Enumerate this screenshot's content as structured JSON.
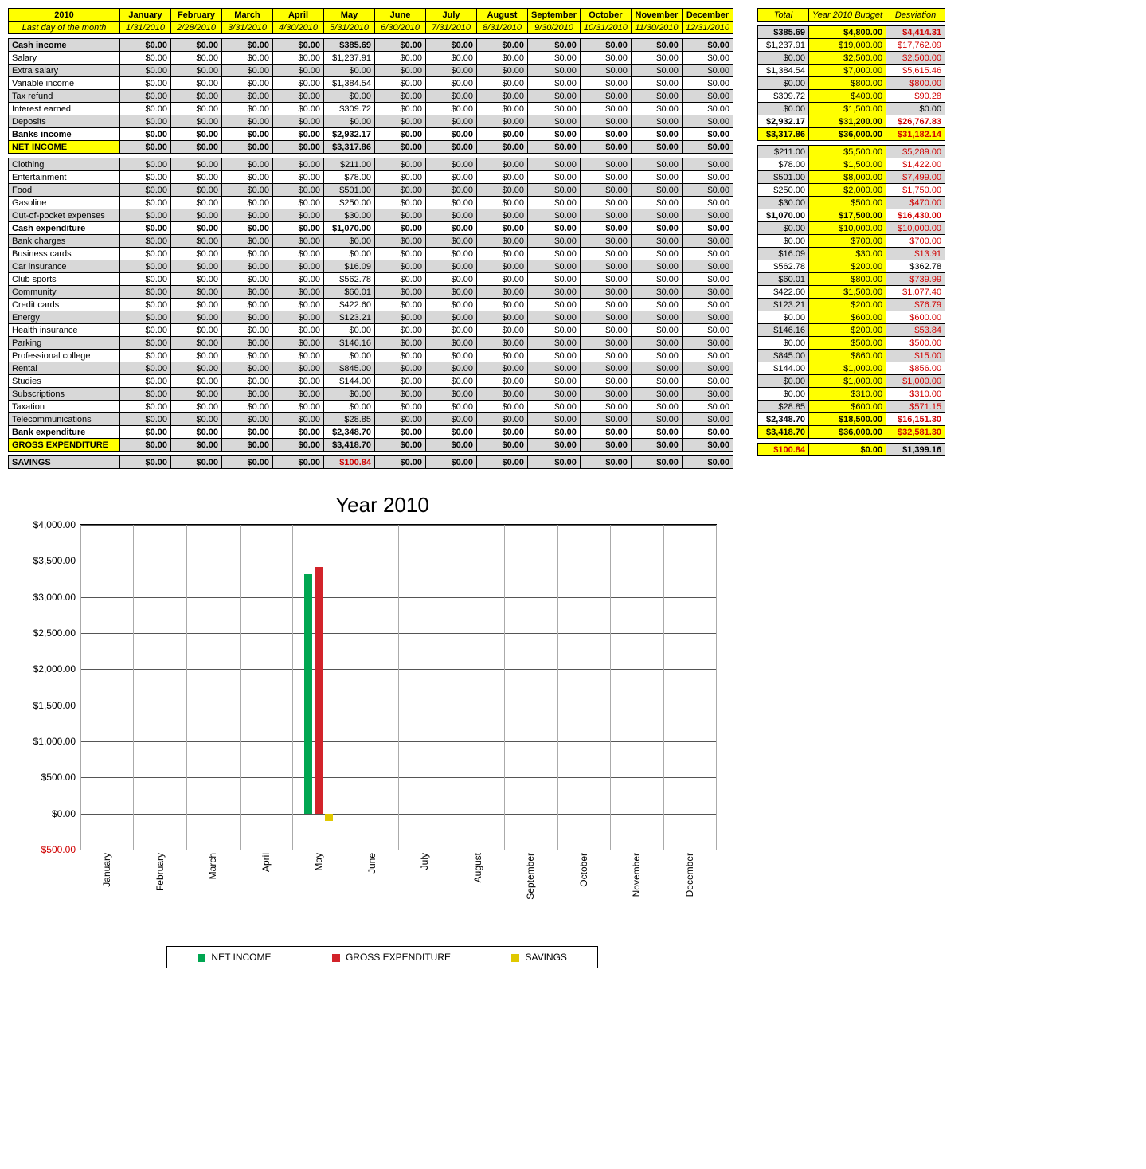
{
  "header": {
    "year_label": "2010",
    "sub_label": "Last day of the month",
    "months": [
      "January",
      "February",
      "March",
      "April",
      "May",
      "June",
      "July",
      "August",
      "September",
      "October",
      "November",
      "December"
    ],
    "dates": [
      "1/31/2010",
      "2/28/2010",
      "3/31/2010",
      "4/30/2010",
      "5/31/2010",
      "6/30/2010",
      "7/31/2010",
      "8/31/2010",
      "9/30/2010",
      "10/31/2010",
      "11/30/2010",
      "12/31/2010"
    ],
    "total_label": "Total",
    "budget_label": "Year 2010 Budget",
    "deviation_label": "Desviation"
  },
  "rows": [
    {
      "label": "Cash income",
      "type": "shade-bold",
      "vals": [
        "$0.00",
        "$0.00",
        "$0.00",
        "$0.00",
        "$385.69",
        "$0.00",
        "$0.00",
        "$0.00",
        "$0.00",
        "$0.00",
        "$0.00",
        "$0.00"
      ],
      "total": "$385.69",
      "budget": "$4,800.00",
      "dev": "$4,414.31",
      "dev_red": true
    },
    {
      "label": "Salary",
      "type": "plain",
      "vals": [
        "$0.00",
        "$0.00",
        "$0.00",
        "$0.00",
        "$1,237.91",
        "$0.00",
        "$0.00",
        "$0.00",
        "$0.00",
        "$0.00",
        "$0.00",
        "$0.00"
      ],
      "total": "$1,237.91",
      "budget": "$19,000.00",
      "dev": "$17,762.09",
      "dev_red": true
    },
    {
      "label": "Extra salary",
      "type": "shade",
      "vals": [
        "$0.00",
        "$0.00",
        "$0.00",
        "$0.00",
        "$0.00",
        "$0.00",
        "$0.00",
        "$0.00",
        "$0.00",
        "$0.00",
        "$0.00",
        "$0.00"
      ],
      "total": "$0.00",
      "budget": "$2,500.00",
      "dev": "$2,500.00",
      "dev_red": true
    },
    {
      "label": "Variable income",
      "type": "plain",
      "vals": [
        "$0.00",
        "$0.00",
        "$0.00",
        "$0.00",
        "$1,384.54",
        "$0.00",
        "$0.00",
        "$0.00",
        "$0.00",
        "$0.00",
        "$0.00",
        "$0.00"
      ],
      "total": "$1,384.54",
      "budget": "$7,000.00",
      "dev": "$5,615.46",
      "dev_red": true
    },
    {
      "label": "Tax refund",
      "type": "shade",
      "vals": [
        "$0.00",
        "$0.00",
        "$0.00",
        "$0.00",
        "$0.00",
        "$0.00",
        "$0.00",
        "$0.00",
        "$0.00",
        "$0.00",
        "$0.00",
        "$0.00"
      ],
      "total": "$0.00",
      "budget": "$800.00",
      "dev": "$800.00",
      "dev_red": true
    },
    {
      "label": "Interest earned",
      "type": "plain",
      "vals": [
        "$0.00",
        "$0.00",
        "$0.00",
        "$0.00",
        "$309.72",
        "$0.00",
        "$0.00",
        "$0.00",
        "$0.00",
        "$0.00",
        "$0.00",
        "$0.00"
      ],
      "total": "$309.72",
      "budget": "$400.00",
      "dev": "$90.28",
      "dev_red": true
    },
    {
      "label": "Deposits",
      "type": "shade",
      "vals": [
        "$0.00",
        "$0.00",
        "$0.00",
        "$0.00",
        "$0.00",
        "$0.00",
        "$0.00",
        "$0.00",
        "$0.00",
        "$0.00",
        "$0.00",
        "$0.00"
      ],
      "total": "$0.00",
      "budget": "$1,500.00",
      "dev": "$0.00",
      "dev_red": false
    },
    {
      "label": "Banks income",
      "type": "plain-bold",
      "vals": [
        "$0.00",
        "$0.00",
        "$0.00",
        "$0.00",
        "$2,932.17",
        "$0.00",
        "$0.00",
        "$0.00",
        "$0.00",
        "$0.00",
        "$0.00",
        "$0.00"
      ],
      "total": "$2,932.17",
      "budget": "$31,200.00",
      "dev": "$26,767.83",
      "dev_red": true
    },
    {
      "label": "NET INCOME",
      "type": "yellow",
      "vals": [
        "$0.00",
        "$0.00",
        "$0.00",
        "$0.00",
        "$3,317.86",
        "$0.00",
        "$0.00",
        "$0.00",
        "$0.00",
        "$0.00",
        "$0.00",
        "$0.00"
      ],
      "total": "$3,317.86",
      "budget": "$36,000.00",
      "dev": "$31,182.14",
      "dev_red": true
    },
    {
      "type": "spacer"
    },
    {
      "label": "Clothing",
      "type": "shade",
      "vals": [
        "$0.00",
        "$0.00",
        "$0.00",
        "$0.00",
        "$211.00",
        "$0.00",
        "$0.00",
        "$0.00",
        "$0.00",
        "$0.00",
        "$0.00",
        "$0.00"
      ],
      "total": "$211.00",
      "budget": "$5,500.00",
      "dev": "$5,289.00",
      "dev_red": true
    },
    {
      "label": "Entertainment",
      "type": "plain",
      "vals": [
        "$0.00",
        "$0.00",
        "$0.00",
        "$0.00",
        "$78.00",
        "$0.00",
        "$0.00",
        "$0.00",
        "$0.00",
        "$0.00",
        "$0.00",
        "$0.00"
      ],
      "total": "$78.00",
      "budget": "$1,500.00",
      "dev": "$1,422.00",
      "dev_red": true
    },
    {
      "label": "Food",
      "type": "shade",
      "vals": [
        "$0.00",
        "$0.00",
        "$0.00",
        "$0.00",
        "$501.00",
        "$0.00",
        "$0.00",
        "$0.00",
        "$0.00",
        "$0.00",
        "$0.00",
        "$0.00"
      ],
      "total": "$501.00",
      "budget": "$8,000.00",
      "dev": "$7,499.00",
      "dev_red": true
    },
    {
      "label": "Gasoline",
      "type": "plain",
      "vals": [
        "$0.00",
        "$0.00",
        "$0.00",
        "$0.00",
        "$250.00",
        "$0.00",
        "$0.00",
        "$0.00",
        "$0.00",
        "$0.00",
        "$0.00",
        "$0.00"
      ],
      "total": "$250.00",
      "budget": "$2,000.00",
      "dev": "$1,750.00",
      "dev_red": true
    },
    {
      "label": "Out-of-pocket expenses",
      "type": "shade",
      "vals": [
        "$0.00",
        "$0.00",
        "$0.00",
        "$0.00",
        "$30.00",
        "$0.00",
        "$0.00",
        "$0.00",
        "$0.00",
        "$0.00",
        "$0.00",
        "$0.00"
      ],
      "total": "$30.00",
      "budget": "$500.00",
      "dev": "$470.00",
      "dev_red": true
    },
    {
      "label": "Cash expenditure",
      "type": "plain-bold",
      "vals": [
        "$0.00",
        "$0.00",
        "$0.00",
        "$0.00",
        "$1,070.00",
        "$0.00",
        "$0.00",
        "$0.00",
        "$0.00",
        "$0.00",
        "$0.00",
        "$0.00"
      ],
      "total": "$1,070.00",
      "budget": "$17,500.00",
      "dev": "$16,430.00",
      "dev_red": true
    },
    {
      "label": "Bank charges",
      "type": "shade",
      "vals": [
        "$0.00",
        "$0.00",
        "$0.00",
        "$0.00",
        "$0.00",
        "$0.00",
        "$0.00",
        "$0.00",
        "$0.00",
        "$0.00",
        "$0.00",
        "$0.00"
      ],
      "total": "$0.00",
      "budget": "$10,000.00",
      "dev": "$10,000.00",
      "dev_red": true
    },
    {
      "label": "Business cards",
      "type": "plain",
      "vals": [
        "$0.00",
        "$0.00",
        "$0.00",
        "$0.00",
        "$0.00",
        "$0.00",
        "$0.00",
        "$0.00",
        "$0.00",
        "$0.00",
        "$0.00",
        "$0.00"
      ],
      "total": "$0.00",
      "budget": "$700.00",
      "dev": "$700.00",
      "dev_red": true
    },
    {
      "label": "Car insurance",
      "type": "shade",
      "vals": [
        "$0.00",
        "$0.00",
        "$0.00",
        "$0.00",
        "$16.09",
        "$0.00",
        "$0.00",
        "$0.00",
        "$0.00",
        "$0.00",
        "$0.00",
        "$0.00"
      ],
      "total": "$16.09",
      "budget": "$30.00",
      "dev": "$13.91",
      "dev_red": true
    },
    {
      "label": "Club sports",
      "type": "plain",
      "vals": [
        "$0.00",
        "$0.00",
        "$0.00",
        "$0.00",
        "$562.78",
        "$0.00",
        "$0.00",
        "$0.00",
        "$0.00",
        "$0.00",
        "$0.00",
        "$0.00"
      ],
      "total": "$562.78",
      "budget": "$200.00",
      "dev": "$362.78",
      "dev_red": false
    },
    {
      "label": "Community",
      "type": "shade",
      "vals": [
        "$0.00",
        "$0.00",
        "$0.00",
        "$0.00",
        "$60.01",
        "$0.00",
        "$0.00",
        "$0.00",
        "$0.00",
        "$0.00",
        "$0.00",
        "$0.00"
      ],
      "total": "$60.01",
      "budget": "$800.00",
      "dev": "$739.99",
      "dev_red": true
    },
    {
      "label": "Credit cards",
      "type": "plain",
      "vals": [
        "$0.00",
        "$0.00",
        "$0.00",
        "$0.00",
        "$422.60",
        "$0.00",
        "$0.00",
        "$0.00",
        "$0.00",
        "$0.00",
        "$0.00",
        "$0.00"
      ],
      "total": "$422.60",
      "budget": "$1,500.00",
      "dev": "$1,077.40",
      "dev_red": true
    },
    {
      "label": "Energy",
      "type": "shade",
      "vals": [
        "$0.00",
        "$0.00",
        "$0.00",
        "$0.00",
        "$123.21",
        "$0.00",
        "$0.00",
        "$0.00",
        "$0.00",
        "$0.00",
        "$0.00",
        "$0.00"
      ],
      "total": "$123.21",
      "budget": "$200.00",
      "dev": "$76.79",
      "dev_red": true
    },
    {
      "label": "Health insurance",
      "type": "plain",
      "vals": [
        "$0.00",
        "$0.00",
        "$0.00",
        "$0.00",
        "$0.00",
        "$0.00",
        "$0.00",
        "$0.00",
        "$0.00",
        "$0.00",
        "$0.00",
        "$0.00"
      ],
      "total": "$0.00",
      "budget": "$600.00",
      "dev": "$600.00",
      "dev_red": true
    },
    {
      "label": "Parking",
      "type": "shade",
      "vals": [
        "$0.00",
        "$0.00",
        "$0.00",
        "$0.00",
        "$146.16",
        "$0.00",
        "$0.00",
        "$0.00",
        "$0.00",
        "$0.00",
        "$0.00",
        "$0.00"
      ],
      "total": "$146.16",
      "budget": "$200.00",
      "dev": "$53.84",
      "dev_red": true
    },
    {
      "label": "Professional college",
      "type": "plain",
      "vals": [
        "$0.00",
        "$0.00",
        "$0.00",
        "$0.00",
        "$0.00",
        "$0.00",
        "$0.00",
        "$0.00",
        "$0.00",
        "$0.00",
        "$0.00",
        "$0.00"
      ],
      "total": "$0.00",
      "budget": "$500.00",
      "dev": "$500.00",
      "dev_red": true
    },
    {
      "label": "Rental",
      "type": "shade",
      "vals": [
        "$0.00",
        "$0.00",
        "$0.00",
        "$0.00",
        "$845.00",
        "$0.00",
        "$0.00",
        "$0.00",
        "$0.00",
        "$0.00",
        "$0.00",
        "$0.00"
      ],
      "total": "$845.00",
      "budget": "$860.00",
      "dev": "$15.00",
      "dev_red": true
    },
    {
      "label": "Studies",
      "type": "plain",
      "vals": [
        "$0.00",
        "$0.00",
        "$0.00",
        "$0.00",
        "$144.00",
        "$0.00",
        "$0.00",
        "$0.00",
        "$0.00",
        "$0.00",
        "$0.00",
        "$0.00"
      ],
      "total": "$144.00",
      "budget": "$1,000.00",
      "dev": "$856.00",
      "dev_red": true
    },
    {
      "label": "Subscriptions",
      "type": "shade",
      "vals": [
        "$0.00",
        "$0.00",
        "$0.00",
        "$0.00",
        "$0.00",
        "$0.00",
        "$0.00",
        "$0.00",
        "$0.00",
        "$0.00",
        "$0.00",
        "$0.00"
      ],
      "total": "$0.00",
      "budget": "$1,000.00",
      "dev": "$1,000.00",
      "dev_red": true
    },
    {
      "label": "Taxation",
      "type": "plain",
      "vals": [
        "$0.00",
        "$0.00",
        "$0.00",
        "$0.00",
        "$0.00",
        "$0.00",
        "$0.00",
        "$0.00",
        "$0.00",
        "$0.00",
        "$0.00",
        "$0.00"
      ],
      "total": "$0.00",
      "budget": "$310.00",
      "dev": "$310.00",
      "dev_red": true
    },
    {
      "label": "Telecommunications",
      "type": "shade",
      "vals": [
        "$0.00",
        "$0.00",
        "$0.00",
        "$0.00",
        "$28.85",
        "$0.00",
        "$0.00",
        "$0.00",
        "$0.00",
        "$0.00",
        "$0.00",
        "$0.00"
      ],
      "total": "$28.85",
      "budget": "$600.00",
      "dev": "$571.15",
      "dev_red": true
    },
    {
      "label": "Bank expenditure",
      "type": "plain-bold",
      "vals": [
        "$0.00",
        "$0.00",
        "$0.00",
        "$0.00",
        "$2,348.70",
        "$0.00",
        "$0.00",
        "$0.00",
        "$0.00",
        "$0.00",
        "$0.00",
        "$0.00"
      ],
      "total": "$2,348.70",
      "budget": "$18,500.00",
      "dev": "$16,151.30",
      "dev_red": true
    },
    {
      "label": "GROSS EXPENDITURE",
      "type": "yellow",
      "vals": [
        "$0.00",
        "$0.00",
        "$0.00",
        "$0.00",
        "$3,418.70",
        "$0.00",
        "$0.00",
        "$0.00",
        "$0.00",
        "$0.00",
        "$0.00",
        "$0.00"
      ],
      "total": "$3,418.70",
      "budget": "$36,000.00",
      "dev": "$32,581.30",
      "dev_red": true
    },
    {
      "type": "spacer"
    },
    {
      "label": "SAVINGS",
      "type": "savings",
      "vals": [
        "$0.00",
        "$0.00",
        "$0.00",
        "$0.00",
        "$100.84",
        "$0.00",
        "$0.00",
        "$0.00",
        "$0.00",
        "$0.00",
        "$0.00",
        "$0.00"
      ],
      "may_red": true,
      "total": "$100.84",
      "total_red": true,
      "budget": "$0.00",
      "dev": "$1,399.16",
      "dev_red": false
    }
  ],
  "chart_data": {
    "type": "bar",
    "title": "Year 2010",
    "categories": [
      "January",
      "February",
      "March",
      "April",
      "May",
      "June",
      "July",
      "August",
      "September",
      "October",
      "November",
      "December"
    ],
    "series": [
      {
        "name": "NET INCOME",
        "color": "#00a651",
        "values": [
          0,
          0,
          0,
          0,
          3317.86,
          0,
          0,
          0,
          0,
          0,
          0,
          0
        ]
      },
      {
        "name": "GROSS EXPENDITURE",
        "color": "#d2232a",
        "values": [
          0,
          0,
          0,
          0,
          3418.7,
          0,
          0,
          0,
          0,
          0,
          0,
          0
        ]
      },
      {
        "name": "SAVINGS",
        "color": "#e0c800",
        "values": [
          0,
          0,
          0,
          0,
          -100.84,
          0,
          0,
          0,
          0,
          0,
          0,
          0
        ]
      }
    ],
    "ylim": [
      -500,
      4000
    ],
    "yticks": [
      -500,
      0,
      500,
      1000,
      1500,
      2000,
      2500,
      3000,
      3500,
      4000
    ],
    "ytick_labels": [
      "$500.00",
      "$0.00",
      "$500.00",
      "$1,000.00",
      "$1,500.00",
      "$2,000.00",
      "$2,500.00",
      "$3,000.00",
      "$3,500.00",
      "$4,000.00"
    ]
  }
}
